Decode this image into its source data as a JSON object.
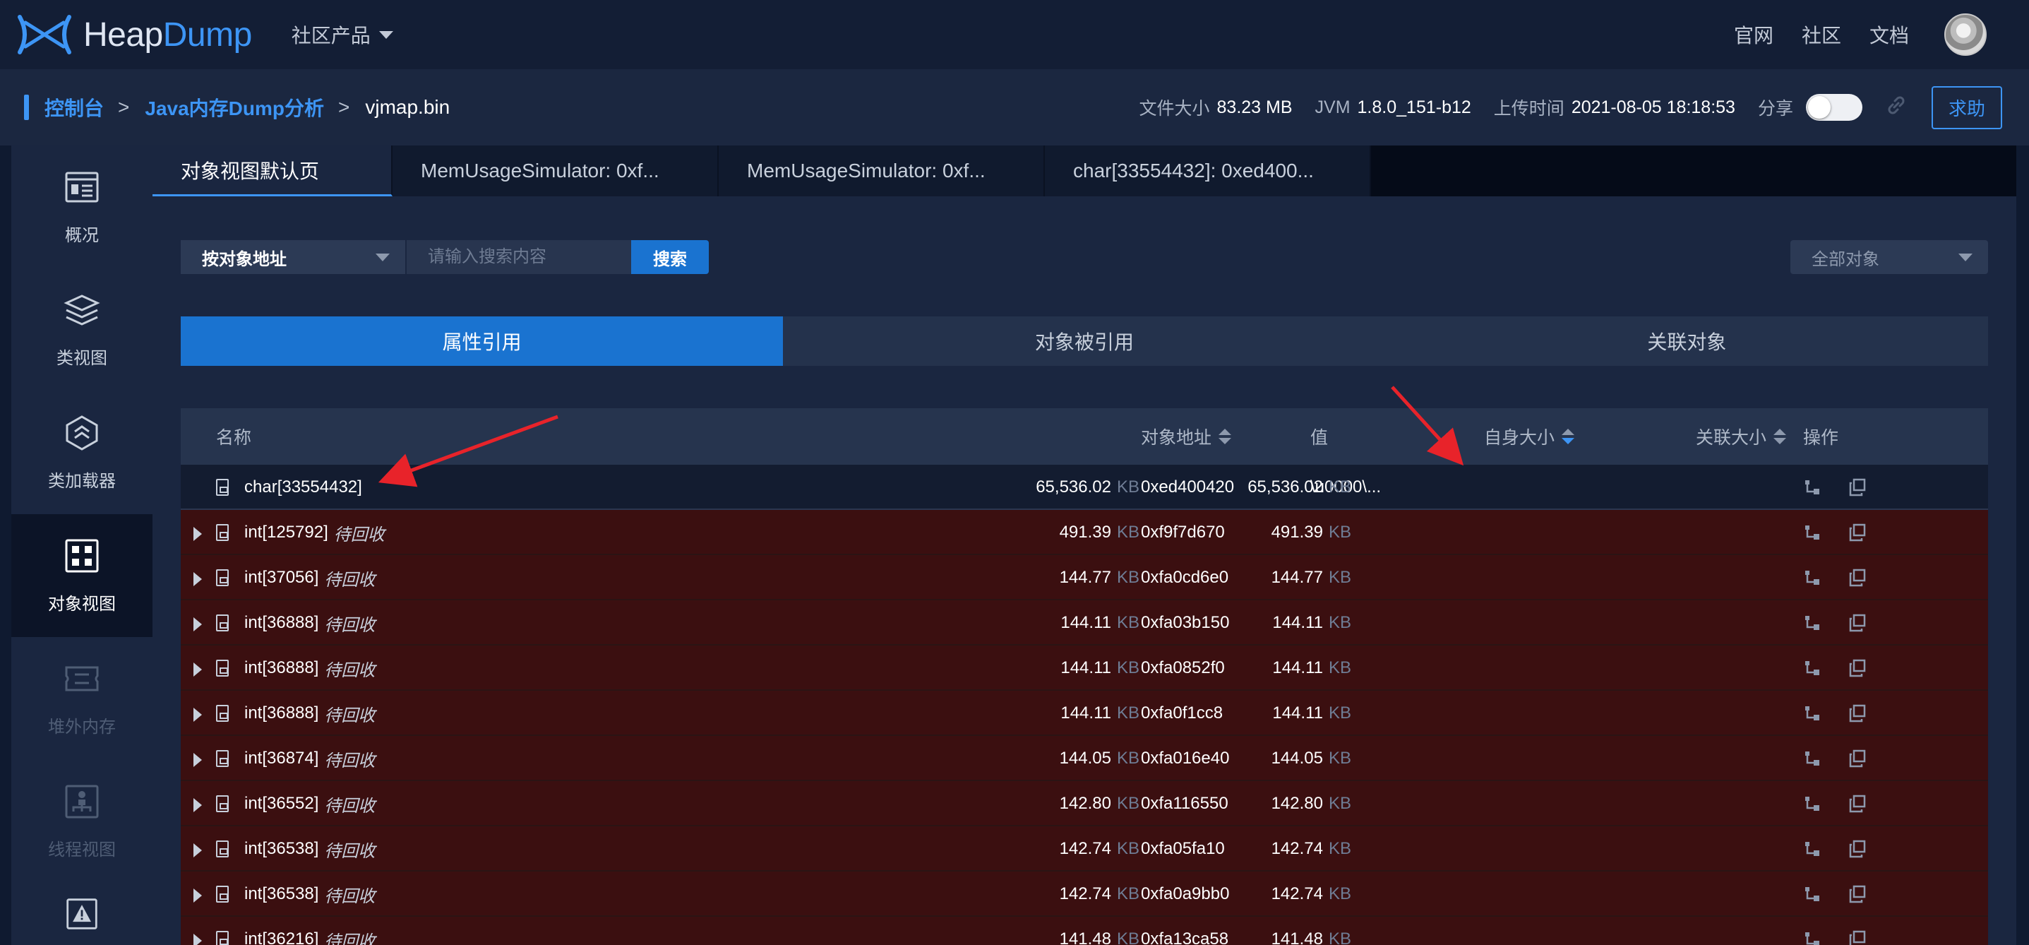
{
  "brand": {
    "heap": "Heap",
    "dump": "Dump"
  },
  "nav": {
    "product_menu": "社区产品",
    "links": [
      "官网",
      "社区",
      "文档"
    ]
  },
  "breadcrumb": {
    "items": [
      "控制台",
      "Java内存Dump分析"
    ],
    "separator": ">",
    "current": "vjmap.bin"
  },
  "meta": {
    "file_size_label": "文件大小",
    "file_size": "83.23 MB",
    "jvm_label": "JVM",
    "jvm": "1.8.0_151-b12",
    "upload_label": "上传时间",
    "upload_time": "2021-08-05 18:18:53",
    "share_label": "分享",
    "help_label": "求助"
  },
  "sidebar": {
    "items": [
      {
        "label": "概况",
        "icon": "overview-icon"
      },
      {
        "label": "类视图",
        "icon": "layers-icon"
      },
      {
        "label": "类加载器",
        "icon": "classloader-icon"
      },
      {
        "label": "对象视图",
        "icon": "grid-icon"
      },
      {
        "label": "堆外内存",
        "icon": "offheap-icon"
      },
      {
        "label": "线程视图",
        "icon": "thread-icon"
      }
    ]
  },
  "tabs": [
    "对象视图默认页",
    "MemUsageSimulator: 0xf...",
    "MemUsageSimulator: 0xf...",
    "char[33554432]: 0xed400..."
  ],
  "search": {
    "by_label": "按对象地址",
    "placeholder": "请输入搜索内容",
    "button": "搜索",
    "filter_label": "全部对象"
  },
  "ref_tabs": [
    "属性引用",
    "对象被引用",
    "关联对象"
  ],
  "table": {
    "headers": {
      "name": "名称",
      "addr": "对象地址",
      "value": "值",
      "self": "自身大小",
      "retained": "关联大小",
      "ops": "操作"
    },
    "unit": "KB",
    "rows": [
      {
        "name": "char[33554432]",
        "tag": "",
        "addr": "0xed400420",
        "value": "\\u0000\\...",
        "self": "65,536.02",
        "retained": "65,536.02"
      },
      {
        "name": "int[125792]",
        "tag": "待回收",
        "addr": "0xf9f7d670",
        "value": "",
        "self": "491.39",
        "retained": "491.39"
      },
      {
        "name": "int[37056]",
        "tag": "待回收",
        "addr": "0xfa0cd6e0",
        "value": "",
        "self": "144.77",
        "retained": "144.77"
      },
      {
        "name": "int[36888]",
        "tag": "待回收",
        "addr": "0xfa03b150",
        "value": "",
        "self": "144.11",
        "retained": "144.11"
      },
      {
        "name": "int[36888]",
        "tag": "待回收",
        "addr": "0xfa0852f0",
        "value": "",
        "self": "144.11",
        "retained": "144.11"
      },
      {
        "name": "int[36888]",
        "tag": "待回收",
        "addr": "0xfa0f1cc8",
        "value": "",
        "self": "144.11",
        "retained": "144.11"
      },
      {
        "name": "int[36874]",
        "tag": "待回收",
        "addr": "0xfa016e40",
        "value": "",
        "self": "144.05",
        "retained": "144.05"
      },
      {
        "name": "int[36552]",
        "tag": "待回收",
        "addr": "0xfa116550",
        "value": "",
        "self": "142.80",
        "retained": "142.80"
      },
      {
        "name": "int[36538]",
        "tag": "待回收",
        "addr": "0xfa05fa10",
        "value": "",
        "self": "142.74",
        "retained": "142.74"
      },
      {
        "name": "int[36538]",
        "tag": "待回收",
        "addr": "0xfa0a9bb0",
        "value": "",
        "self": "142.74",
        "retained": "142.74"
      },
      {
        "name": "int[36216]",
        "tag": "待回收",
        "addr": "0xfa13ca58",
        "value": "",
        "self": "141.48",
        "retained": "141.48"
      }
    ]
  },
  "colors": {
    "accent": "#3d95f5",
    "active_tab": "#1a73d0",
    "row_highlight": "#3b0f10",
    "annotation_arrow": "#e8232a"
  }
}
